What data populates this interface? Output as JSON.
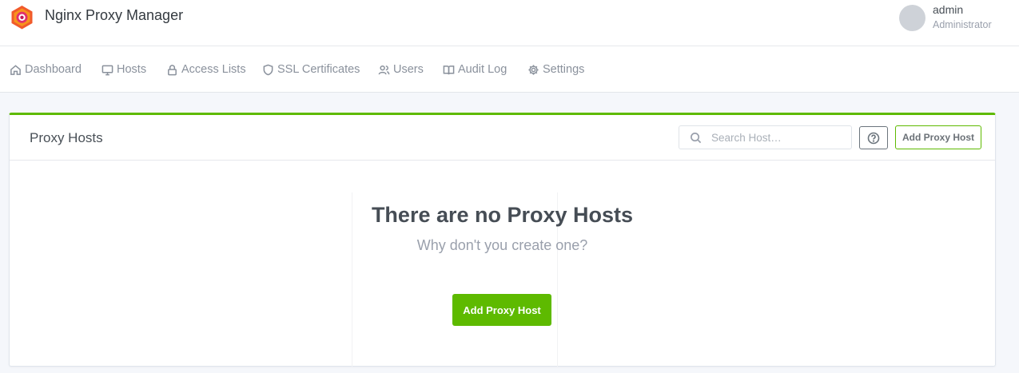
{
  "app": {
    "title": "Nginx Proxy Manager",
    "logo_icon": "nginx-proxy-manager-logo",
    "accent_color": "#5eba00"
  },
  "user": {
    "name": "admin",
    "role": "Administrator"
  },
  "nav": {
    "items": [
      {
        "label": "Dashboard",
        "icon": "home-icon"
      },
      {
        "label": "Hosts",
        "icon": "monitor-icon"
      },
      {
        "label": "Access Lists",
        "icon": "lock-icon"
      },
      {
        "label": "SSL Certificates",
        "icon": "shield-icon"
      },
      {
        "label": "Users",
        "icon": "users-icon"
      },
      {
        "label": "Audit Log",
        "icon": "book-icon"
      },
      {
        "label": "Settings",
        "icon": "gear-icon"
      }
    ]
  },
  "card": {
    "title": "Proxy Hosts",
    "search_placeholder": "Search Host…",
    "help_icon": "help-circle-icon",
    "add_button_label": "Add Proxy Host"
  },
  "empty_state": {
    "title": "There are no Proxy Hosts",
    "subtitle": "Why don't you create one?",
    "button_label": "Add Proxy Host"
  }
}
